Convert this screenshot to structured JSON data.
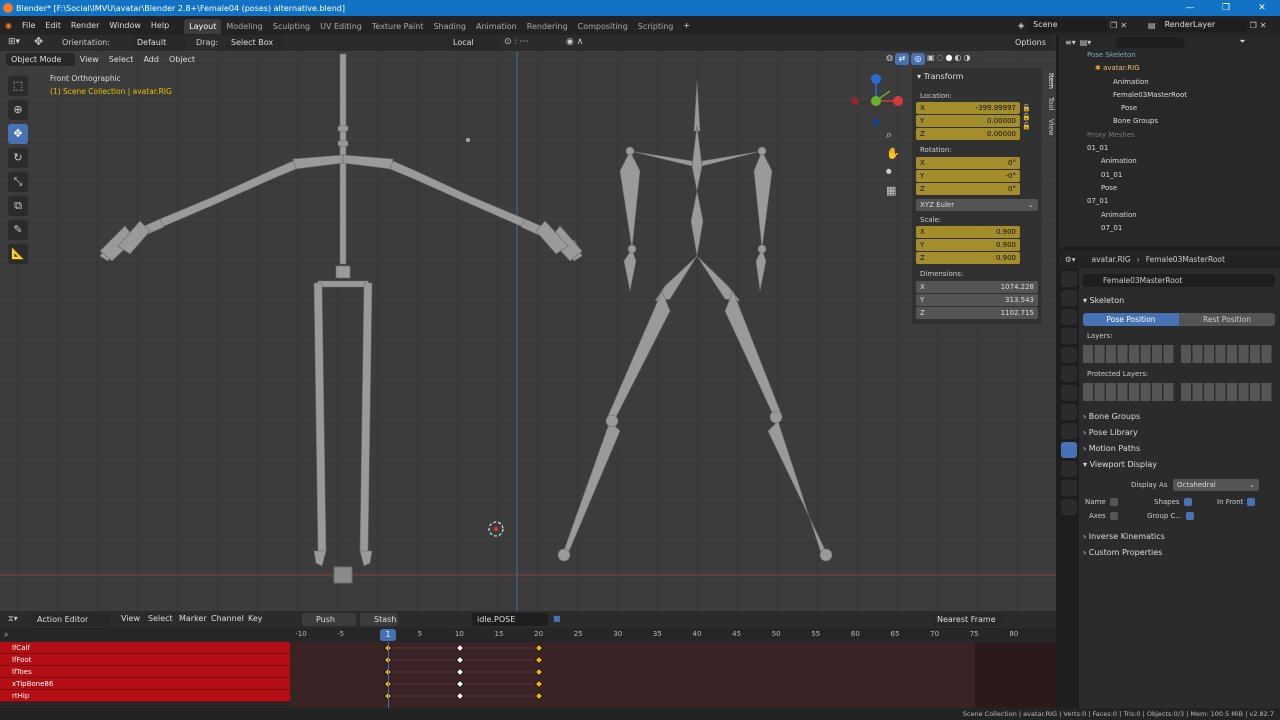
{
  "window": {
    "title": "Blender* [F:\\Social\\IMVU\\avatar\\Blender 2.8+\\Female04 (poses) alternative.blend]"
  },
  "menu": [
    "File",
    "Edit",
    "Render",
    "Window",
    "Help"
  ],
  "workspaces": [
    "Layout",
    "Modeling",
    "Sculpting",
    "UV Editing",
    "Texture Paint",
    "Shading",
    "Animation",
    "Rendering",
    "Compositing",
    "Scripting"
  ],
  "scene": {
    "scene_name": "Scene",
    "view_layer": "RenderLayer"
  },
  "vp_header": {
    "orientation_label": "Orientation:",
    "orientation_value": "Default",
    "drag_label": "Drag:",
    "drag_value": "Select Box",
    "pivot": "Local",
    "options": "Options"
  },
  "vp_menu": {
    "mode": "Object Mode",
    "items": [
      "View",
      "Select",
      "Add",
      "Object"
    ]
  },
  "vp_overlay": {
    "view_name": "Front Orthographic",
    "collection": "(1) Scene Collection | avatar.RIG"
  },
  "npanel": {
    "title": "Transform",
    "location_label": "Location:",
    "location": [
      {
        "axis": "X",
        "value": "-399.99997"
      },
      {
        "axis": "Y",
        "value": "0.00000"
      },
      {
        "axis": "Z",
        "value": "0.00000"
      }
    ],
    "rotation_label": "Rotation:",
    "rotation": [
      {
        "axis": "X",
        "value": "0°"
      },
      {
        "axis": "Y",
        "value": "-0°"
      },
      {
        "axis": "Z",
        "value": "0°"
      }
    ],
    "rotation_mode": "XYZ Euler",
    "scale_label": "Scale:",
    "scale": [
      {
        "axis": "X",
        "value": "0.900"
      },
      {
        "axis": "Y",
        "value": "0.900"
      },
      {
        "axis": "Z",
        "value": "0.900"
      }
    ],
    "dimensions_label": "Dimensions:",
    "dimensions": [
      {
        "axis": "X",
        "value": "1074.228"
      },
      {
        "axis": "Y",
        "value": "313.543"
      },
      {
        "axis": "Z",
        "value": "1102.715"
      }
    ],
    "tabs": [
      "Item",
      "Tool",
      "View"
    ]
  },
  "outliner": {
    "rows": [
      "Pose Skeleton",
      "avatar.RIG",
      "Animation",
      "Female03MasterRoot",
      "Pose",
      "Bone Groups",
      "Proxy Meshes",
      "01_01",
      "Animation",
      "01_01",
      "Pose",
      "07_01",
      "Animation",
      "07_01"
    ]
  },
  "properties": {
    "object": "avatar.RIG",
    "bone": "Female03MasterRoot",
    "datablock": "Female03MasterRoot",
    "skeleton_title": "Skeleton",
    "pose_position": "Pose Position",
    "rest_position": "Rest Position",
    "layers_label": "Layers:",
    "protected_label": "Protected Layers:",
    "sections": [
      "Bone Groups",
      "Pose Library",
      "Motion Paths",
      "Viewport Display"
    ],
    "display_as_label": "Display As",
    "display_as": "Octahedral",
    "name_label": "Name",
    "shapes_label": "Shapes",
    "infront_label": "In Front",
    "axes_label": "Axes",
    "groupc_label": "Group C...",
    "sections2": [
      "Inverse Kinematics",
      "Custom Properties"
    ]
  },
  "timeline": {
    "editor": "Action Editor",
    "menus": [
      "View",
      "Select",
      "Marker",
      "Channel",
      "Key"
    ],
    "push_down": "Push Down",
    "stash": "Stash",
    "action": "idle.POSE",
    "snap": "Nearest Frame",
    "frames": [
      "-10",
      "-5",
      "1",
      "5",
      "10",
      "15",
      "20",
      "25",
      "30",
      "35",
      "40",
      "45",
      "50",
      "55",
      "60",
      "65",
      "70",
      "75",
      "80"
    ],
    "current_frame": "1",
    "channels": [
      "lfCalf",
      "lfFoot",
      "lfToes",
      "xTipBone86",
      "rtHip"
    ]
  },
  "status": "Scene Collection | avatar.RIG | Verts:0 | Faces:0 | Tris:0 | Objects:0/3 | Mem: 100.5 MiB | v2.82.7",
  "colors": {
    "accent": "#4772b3",
    "title": "#1273c5",
    "channel": "#b30e14",
    "field_active": "#a38e2b"
  }
}
